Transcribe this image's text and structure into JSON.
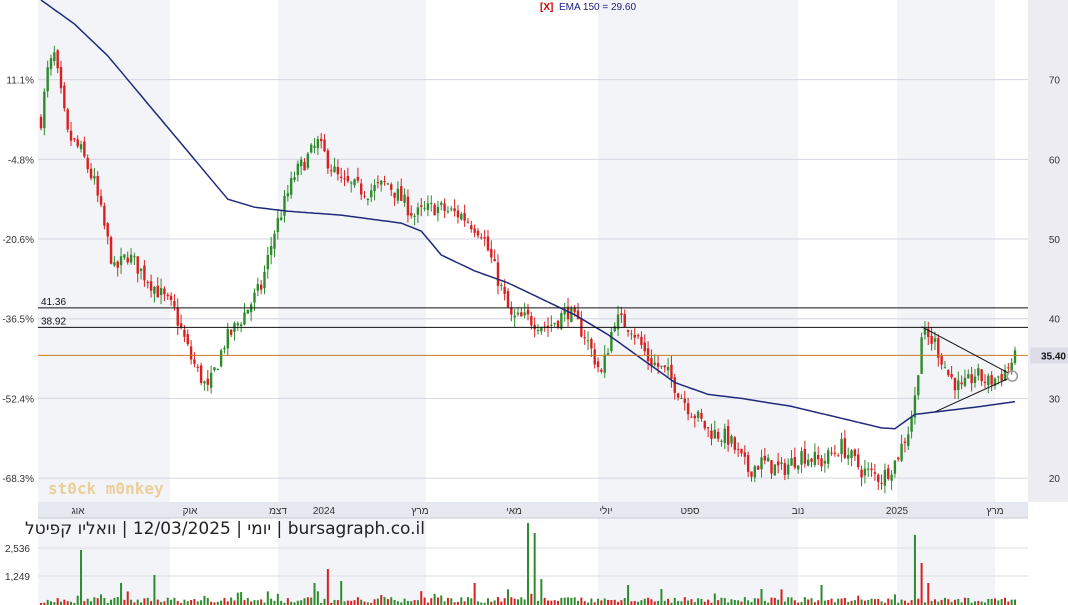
{
  "chart_data": [
    {
      "type": "candlestick",
      "title": "",
      "indicator_label": "[X]",
      "indicator_text": "EMA 150 = 29.60",
      "y_right_ticks": [
        "70",
        "60",
        "50",
        "40",
        "30",
        "20"
      ],
      "y_left_ticks": [
        "11.1%",
        "-4.8%",
        "-20.6%",
        "-36.5%",
        "-52.4%",
        "-68.3%"
      ],
      "x_ticks": [
        "אוג",
        "אוק",
        "דצמ",
        "2024",
        "מרץ",
        "מאי",
        "יולי",
        "ספט",
        "נוב",
        "2025",
        "מרץ"
      ],
      "ylim": [
        17,
        80
      ],
      "last_price": "35.40",
      "levels": [
        {
          "label": "41.36",
          "value": 41.36
        },
        {
          "label": "38.92",
          "value": 38.92
        }
      ],
      "price_line": 35.4,
      "ema_value": 29.6,
      "price_anchors": [
        [
          0,
          65
        ],
        [
          2,
          71
        ],
        [
          4,
          73
        ],
        [
          8,
          63
        ],
        [
          12,
          61
        ],
        [
          16,
          57
        ],
        [
          22,
          46
        ],
        [
          26,
          48
        ],
        [
          30,
          46
        ],
        [
          34,
          44
        ],
        [
          40,
          41
        ],
        [
          45,
          35
        ],
        [
          50,
          31
        ],
        [
          55,
          37
        ],
        [
          60,
          40
        ],
        [
          66,
          44
        ],
        [
          70,
          51
        ],
        [
          76,
          58
        ],
        [
          83,
          62
        ],
        [
          90,
          57
        ],
        [
          98,
          56
        ],
        [
          104,
          57
        ],
        [
          112,
          53
        ],
        [
          118,
          54
        ],
        [
          126,
          53
        ],
        [
          132,
          51
        ],
        [
          137,
          45
        ],
        [
          141,
          40
        ],
        [
          146,
          40
        ],
        [
          152,
          39
        ],
        [
          158,
          41
        ],
        [
          163,
          38
        ],
        [
          168,
          33
        ],
        [
          172,
          40
        ],
        [
          177,
          39
        ],
        [
          182,
          35
        ],
        [
          188,
          33
        ],
        [
          194,
          29
        ],
        [
          200,
          26
        ],
        [
          206,
          25
        ],
        [
          212,
          21
        ],
        [
          216,
          22
        ],
        [
          222,
          21
        ],
        [
          228,
          23
        ],
        [
          234,
          22
        ],
        [
          240,
          24
        ],
        [
          246,
          21
        ],
        [
          252,
          20
        ],
        [
          256,
          22
        ],
        [
          260,
          26
        ],
        [
          262,
          30
        ],
        [
          264,
          38
        ],
        [
          268,
          37
        ],
        [
          272,
          33
        ],
        [
          276,
          31
        ],
        [
          280,
          33
        ],
        [
          284,
          32
        ],
        [
          288,
          33
        ],
        [
          292,
          35
        ]
      ],
      "ema_anchors": [
        [
          0,
          80
        ],
        [
          10,
          77
        ],
        [
          20,
          73
        ],
        [
          30,
          68
        ],
        [
          40,
          63
        ],
        [
          48,
          59
        ],
        [
          56,
          55
        ],
        [
          64,
          54
        ],
        [
          74,
          53.5
        ],
        [
          90,
          53
        ],
        [
          108,
          52
        ],
        [
          114,
          51
        ],
        [
          120,
          48
        ],
        [
          130,
          46
        ],
        [
          140,
          44.5
        ],
        [
          150,
          42.5
        ],
        [
          160,
          40.5
        ],
        [
          170,
          38
        ],
        [
          180,
          35
        ],
        [
          190,
          32
        ],
        [
          200,
          30.5
        ],
        [
          210,
          30
        ],
        [
          225,
          29
        ],
        [
          235,
          28
        ],
        [
          245,
          27
        ],
        [
          252,
          26.3
        ],
        [
          256,
          26.2
        ],
        [
          262,
          28
        ],
        [
          272,
          28.5
        ],
        [
          282,
          29
        ],
        [
          292,
          29.6
        ]
      ],
      "volume_ticks": [
        "2,536",
        "1,249"
      ],
      "volume_spikes": [
        [
          12,
          55
        ],
        [
          24,
          22
        ],
        [
          34,
          30
        ],
        [
          82,
          22
        ],
        [
          86,
          36
        ],
        [
          90,
          24
        ],
        [
          130,
          22
        ],
        [
          146,
          82
        ],
        [
          148,
          72
        ],
        [
          150,
          26
        ],
        [
          176,
          20
        ],
        [
          186,
          16
        ],
        [
          216,
          16
        ],
        [
          234,
          20
        ],
        [
          262,
          70
        ],
        [
          264,
          42
        ],
        [
          266,
          22
        ]
      ]
    }
  ],
  "caption": "יומי | 12/03/2025 | וואליו קפיטל | bursagraph.co.il",
  "watermark": "st0ck m0nkey"
}
